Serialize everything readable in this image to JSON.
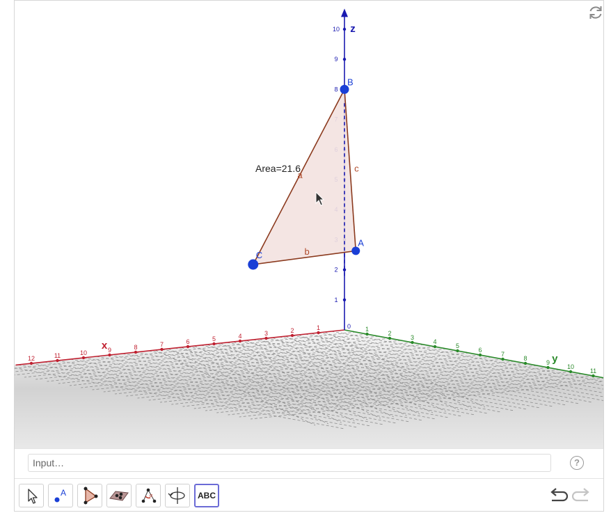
{
  "view3d": {
    "area_label": "Area=21.6",
    "axes": {
      "x": {
        "name": "x",
        "ticks": [
          "1",
          "2",
          "3",
          "4",
          "5",
          "6",
          "7",
          "8",
          "9",
          "10",
          "11",
          "12"
        ],
        "color": "#c02030"
      },
      "y": {
        "name": "y",
        "ticks": [
          "1",
          "2",
          "3",
          "4",
          "5",
          "6",
          "7",
          "8",
          "9",
          "10",
          "11"
        ],
        "color": "#2a8a2a"
      },
      "z": {
        "name": "z",
        "ticks": [
          "1",
          "2",
          "3",
          "4",
          "5",
          "6",
          "7",
          "8",
          "9",
          "10"
        ],
        "color": "#1a1ab0"
      },
      "origin": "0"
    },
    "points": [
      {
        "name": "A",
        "coords": [
          0,
          0.5,
          2.7
        ]
      },
      {
        "name": "B",
        "coords": [
          0,
          0,
          8
        ]
      },
      {
        "name": "C",
        "coords": [
          3.5,
          0,
          2.5
        ]
      }
    ],
    "segments": [
      {
        "name": "a",
        "from": "B",
        "to": "C"
      },
      {
        "name": "b",
        "from": "C",
        "to": "A"
      },
      {
        "name": "c",
        "from": "A",
        "to": "B"
      }
    ],
    "polygon_fill": "#f3e2e0",
    "segment_color": "#8b3a1e",
    "point_color": "#1a3fd6"
  },
  "input_bar": {
    "placeholder": "Input…",
    "help": "?"
  },
  "toolbar": {
    "tools": [
      {
        "name": "move-tool",
        "label": ""
      },
      {
        "name": "point-tool",
        "label": ""
      },
      {
        "name": "polygon-tool",
        "label": ""
      },
      {
        "name": "plane-tool",
        "label": ""
      },
      {
        "name": "angle-tool",
        "label": ""
      },
      {
        "name": "rotate-view-tool",
        "label": ""
      },
      {
        "name": "text-tool",
        "label": "ABC"
      }
    ],
    "active_tool": "text-tool"
  }
}
